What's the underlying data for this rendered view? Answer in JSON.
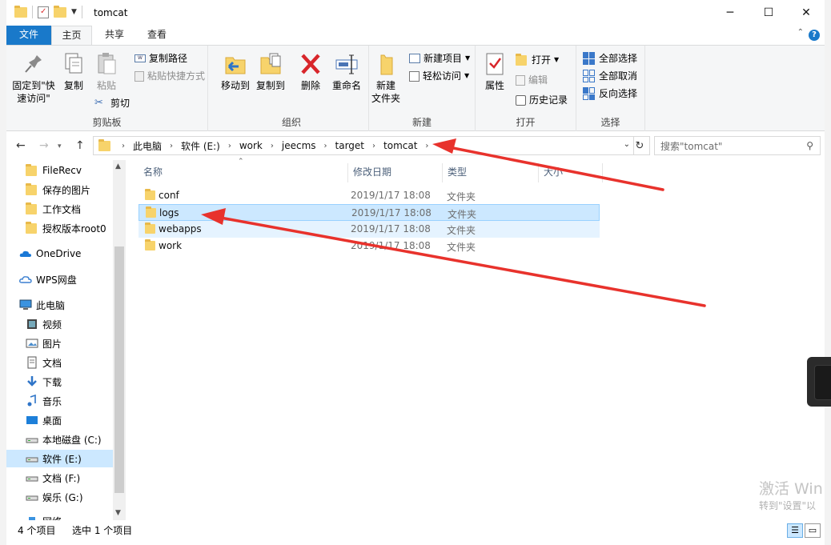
{
  "window": {
    "title": "tomcat",
    "controls": {
      "minimize": "─",
      "maximize": "☐",
      "close": "✕"
    }
  },
  "tabs": [
    {
      "label": "文件"
    },
    {
      "label": "主页"
    },
    {
      "label": "共享"
    },
    {
      "label": "查看"
    }
  ],
  "ribbon": {
    "clipboard": {
      "label": "剪贴板",
      "pin_line1": "固定到\"快",
      "pin_line2": "速访问\"",
      "copy": "复制",
      "paste": "粘贴",
      "copy_path": "复制路径",
      "paste_shortcut": "粘贴快捷方式",
      "cut": "剪切"
    },
    "organize": {
      "label": "组织",
      "move_to": "移动到",
      "copy_to": "复制到",
      "delete": "删除",
      "rename": "重命名"
    },
    "new": {
      "label": "新建",
      "new_folder_line1": "新建",
      "new_folder_line2": "文件夹",
      "new_item": "新建项目",
      "easy_access": "轻松访问"
    },
    "open": {
      "label": "打开",
      "properties": "属性",
      "open": "打开",
      "edit": "编辑",
      "history": "历史记录"
    },
    "select": {
      "label": "选择",
      "select_all": "全部选择",
      "select_none": "全部取消",
      "invert": "反向选择"
    }
  },
  "address": {
    "crumbs": [
      "此电脑",
      "软件 (E:)",
      "work",
      "jeecms",
      "target",
      "tomcat"
    ],
    "search_placeholder": "搜索\"tomcat\""
  },
  "nav_pane": [
    {
      "label": "FileRecv",
      "icon": "folder-icon"
    },
    {
      "label": "保存的图片",
      "icon": "folder-icon"
    },
    {
      "label": "工作文档",
      "icon": "folder-icon"
    },
    {
      "label": "授权版本root0",
      "icon": "folder-icon"
    },
    {
      "label": "OneDrive",
      "icon": "onedrive-icon"
    },
    {
      "label": "WPS网盘",
      "icon": "cloud-icon"
    },
    {
      "label": "此电脑",
      "icon": "computer-icon"
    },
    {
      "label": "视频",
      "icon": "video-icon"
    },
    {
      "label": "图片",
      "icon": "picture-icon"
    },
    {
      "label": "文档",
      "icon": "document-icon"
    },
    {
      "label": "下载",
      "icon": "download-icon"
    },
    {
      "label": "音乐",
      "icon": "music-icon"
    },
    {
      "label": "桌面",
      "icon": "desktop-icon"
    },
    {
      "label": "本地磁盘 (C:)",
      "icon": "drive-icon"
    },
    {
      "label": "软件 (E:)",
      "icon": "drive-icon"
    },
    {
      "label": "文档 (F:)",
      "icon": "drive-icon"
    },
    {
      "label": "娱乐 (G:)",
      "icon": "drive-icon"
    },
    {
      "label": "网络",
      "icon": "network-icon"
    }
  ],
  "columns": [
    "名称",
    "修改日期",
    "类型",
    "大小"
  ],
  "files": [
    {
      "name": "conf",
      "date": "2019/1/17 18:08",
      "type": "文件夹"
    },
    {
      "name": "logs",
      "date": "2019/1/17 18:08",
      "type": "文件夹"
    },
    {
      "name": "webapps",
      "date": "2019/1/17 18:08",
      "type": "文件夹"
    },
    {
      "name": "work",
      "date": "2019/1/17 18:08",
      "type": "文件夹"
    }
  ],
  "status": {
    "count": "4 个项目",
    "selected": "选中 1 个项目"
  },
  "watermark": {
    "line1": "激活 Win",
    "line2": "转到\"设置\"以"
  },
  "colors": {
    "file_tab": "#1979ca",
    "selection": "#cce8ff",
    "arrow": "#e8322c"
  }
}
